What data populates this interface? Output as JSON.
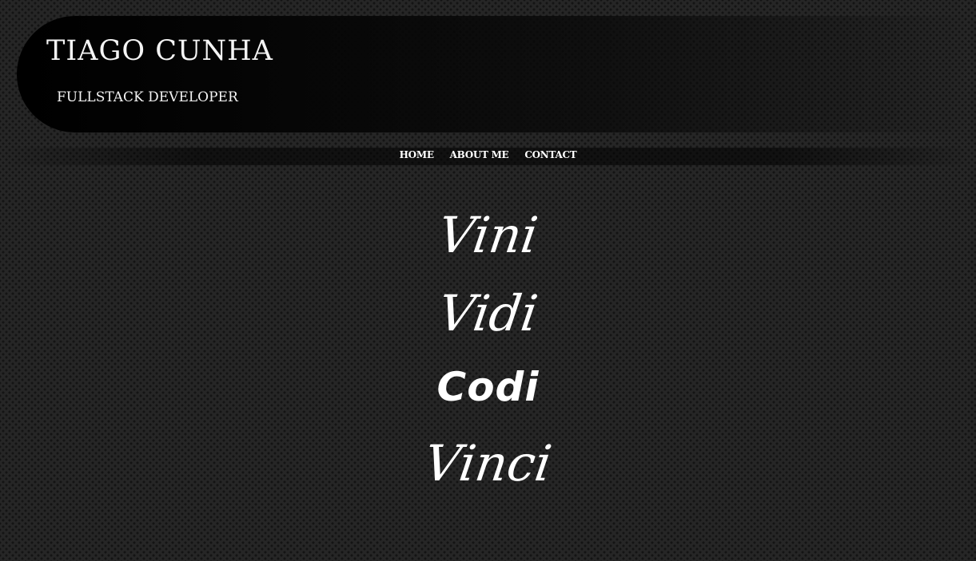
{
  "header": {
    "title": "TIAGO CUNHA",
    "subtitle": "FULLSTACK DEVELOPER"
  },
  "nav": {
    "items": [
      {
        "label": "HOME"
      },
      {
        "label": "ABOUT ME"
      },
      {
        "label": "CONTACT"
      }
    ]
  },
  "motto": {
    "line1": "Vini",
    "line2": "Vidi",
    "line3": "Codi",
    "line4": "Vinci"
  },
  "colors": {
    "background": "#262626",
    "dot": "#141414",
    "header_band": "#000000",
    "text": "#ffffff"
  }
}
